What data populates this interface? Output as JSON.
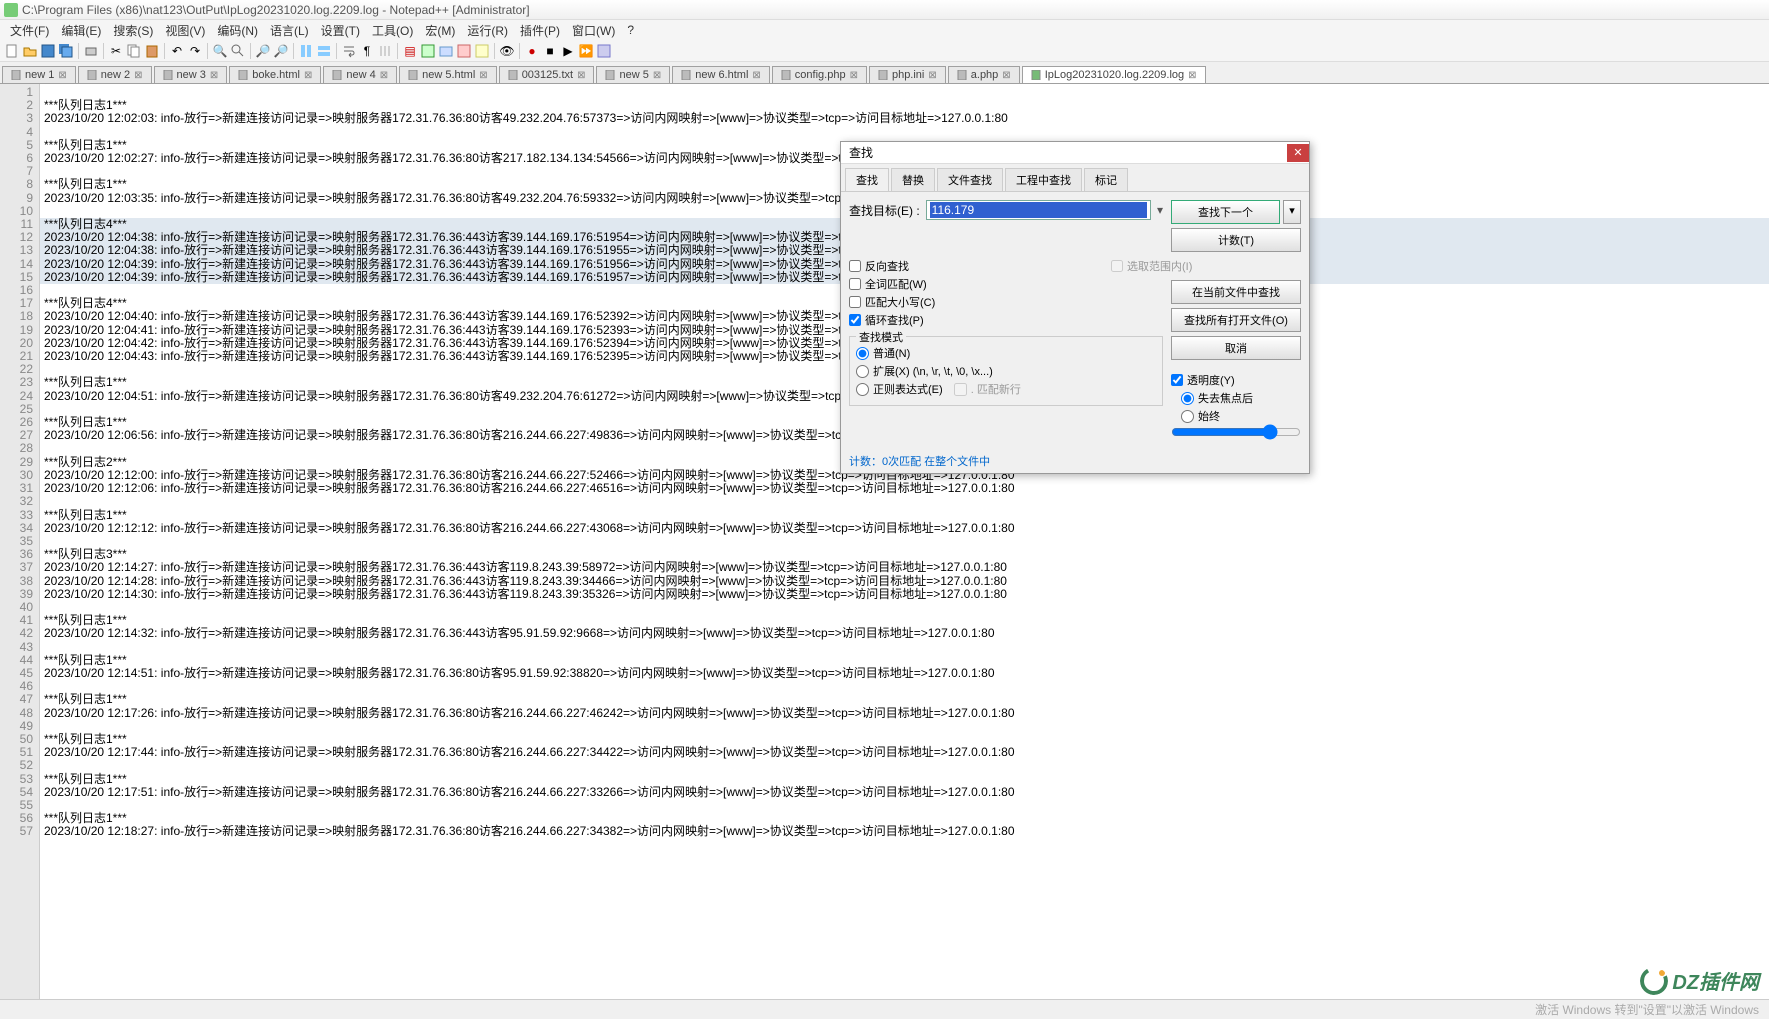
{
  "title": "C:\\Program Files (x86)\\nat123\\OutPut\\IpLog20231020.log.2209.log - Notepad++ [Administrator]",
  "menus": [
    "文件(F)",
    "编辑(E)",
    "搜索(S)",
    "视图(V)",
    "编码(N)",
    "语言(L)",
    "设置(T)",
    "工具(O)",
    "宏(M)",
    "运行(R)",
    "插件(P)",
    "窗口(W)",
    "?"
  ],
  "tabs": [
    {
      "label": "new 1",
      "active": false
    },
    {
      "label": "new 2",
      "active": false
    },
    {
      "label": "new 3",
      "active": false
    },
    {
      "label": "boke.html",
      "active": false
    },
    {
      "label": "new 4",
      "active": false
    },
    {
      "label": "new 5.html",
      "active": false
    },
    {
      "label": "003125.txt",
      "active": false
    },
    {
      "label": "new 5",
      "active": false
    },
    {
      "label": "new 6.html",
      "active": false
    },
    {
      "label": "config.php",
      "active": false
    },
    {
      "label": "php.ini",
      "active": false
    },
    {
      "label": "a.php",
      "active": false
    },
    {
      "label": "IpLog20231020.log.2209.log",
      "active": true
    }
  ],
  "lines": [
    {
      "n": 1,
      "t": ""
    },
    {
      "n": 2,
      "t": "***队列日志1***"
    },
    {
      "n": 3,
      "t": "2023/10/20 12:02:03: info-放行=>新建连接访问记录=>映射服务器172.31.76.36:80访客49.232.204.76:57373=>访问内网映射=>[www]=>协议类型=>tcp=>访问目标地址=>127.0.0.1:80"
    },
    {
      "n": 4,
      "t": ""
    },
    {
      "n": 5,
      "t": "***队列日志1***"
    },
    {
      "n": 6,
      "t": "2023/10/20 12:02:27: info-放行=>新建连接访问记录=>映射服务器172.31.76.36:80访客217.182.134.134:54566=>访问内网映射=>[www]=>协议类型=>tcp=>访问目标地址=>127.0.0.1:80"
    },
    {
      "n": 7,
      "t": ""
    },
    {
      "n": 8,
      "t": "***队列日志1***"
    },
    {
      "n": 9,
      "t": "2023/10/20 12:03:35: info-放行=>新建连接访问记录=>映射服务器172.31.76.36:80访客49.232.204.76:59332=>访问内网映射=>[www]=>协议类型=>tcp=>访问目标地址=>127.0.0.1:80"
    },
    {
      "n": 10,
      "t": ""
    },
    {
      "n": 11,
      "t": "***队列日志4***",
      "hl": true
    },
    {
      "n": 12,
      "t": "2023/10/20 12:04:38: info-放行=>新建连接访问记录=>映射服务器172.31.76.36:443访客39.144.169.176:51954=>访问内网映射=>[www]=>协议类型=>tcp=>访问目标地址=>127.0.0.1:80",
      "hl": true
    },
    {
      "n": 13,
      "t": "2023/10/20 12:04:38: info-放行=>新建连接访问记录=>映射服务器172.31.76.36:443访客39.144.169.176:51955=>访问内网映射=>[www]=>协议类型=>tcp=>访问目标地址=>127.0.0.1:80",
      "hl": true
    },
    {
      "n": 14,
      "t": "2023/10/20 12:04:39: info-放行=>新建连接访问记录=>映射服务器172.31.76.36:443访客39.144.169.176:51956=>访问内网映射=>[www]=>协议类型=>tcp=>访问目标地址=>127.0.0.1:80",
      "hl": true
    },
    {
      "n": 15,
      "t": "2023/10/20 12:04:39: info-放行=>新建连接访问记录=>映射服务器172.31.76.36:443访客39.144.169.176:51957=>访问内网映射=>[www]=>协议类型=>tcp=>访问目标地址=>127.0.0.1:80",
      "hl": true
    },
    {
      "n": 16,
      "t": ""
    },
    {
      "n": 17,
      "t": "***队列日志4***"
    },
    {
      "n": 18,
      "t": "2023/10/20 12:04:40: info-放行=>新建连接访问记录=>映射服务器172.31.76.36:443访客39.144.169.176:52392=>访问内网映射=>[www]=>协议类型=>tcp=>访问目标地址=>127.0.0.1:80"
    },
    {
      "n": 19,
      "t": "2023/10/20 12:04:41: info-放行=>新建连接访问记录=>映射服务器172.31.76.36:443访客39.144.169.176:52393=>访问内网映射=>[www]=>协议类型=>tcp=>访问目标地址=>127.0.0.1:80"
    },
    {
      "n": 20,
      "t": "2023/10/20 12:04:42: info-放行=>新建连接访问记录=>映射服务器172.31.76.36:443访客39.144.169.176:52394=>访问内网映射=>[www]=>协议类型=>tcp=>访问目标地址=>127.0.0.1:80"
    },
    {
      "n": 21,
      "t": "2023/10/20 12:04:43: info-放行=>新建连接访问记录=>映射服务器172.31.76.36:443访客39.144.169.176:52395=>访问内网映射=>[www]=>协议类型=>tcp=>访问目标地址=>127.0.0.1:80"
    },
    {
      "n": 22,
      "t": ""
    },
    {
      "n": 23,
      "t": "***队列日志1***"
    },
    {
      "n": 24,
      "t": "2023/10/20 12:04:51: info-放行=>新建连接访问记录=>映射服务器172.31.76.36:80访客49.232.204.76:61272=>访问内网映射=>[www]=>协议类型=>tcp=>访问目标地址=>127.0.0.1:80"
    },
    {
      "n": 25,
      "t": ""
    },
    {
      "n": 26,
      "t": "***队列日志1***"
    },
    {
      "n": 27,
      "t": "2023/10/20 12:06:56: info-放行=>新建连接访问记录=>映射服务器172.31.76.36:80访客216.244.66.227:49836=>访问内网映射=>[www]=>协议类型=>tcp=>访问目标地址=>127.0.0.1:80"
    },
    {
      "n": 28,
      "t": ""
    },
    {
      "n": 29,
      "t": "***队列日志2***"
    },
    {
      "n": 30,
      "t": "2023/10/20 12:12:00: info-放行=>新建连接访问记录=>映射服务器172.31.76.36:80访客216.244.66.227:52466=>访问内网映射=>[www]=>协议类型=>tcp=>访问目标地址=>127.0.0.1:80"
    },
    {
      "n": 31,
      "t": "2023/10/20 12:12:06: info-放行=>新建连接访问记录=>映射服务器172.31.76.36:80访客216.244.66.227:46516=>访问内网映射=>[www]=>协议类型=>tcp=>访问目标地址=>127.0.0.1:80"
    },
    {
      "n": 32,
      "t": ""
    },
    {
      "n": 33,
      "t": "***队列日志1***"
    },
    {
      "n": 34,
      "t": "2023/10/20 12:12:12: info-放行=>新建连接访问记录=>映射服务器172.31.76.36:80访客216.244.66.227:43068=>访问内网映射=>[www]=>协议类型=>tcp=>访问目标地址=>127.0.0.1:80"
    },
    {
      "n": 35,
      "t": ""
    },
    {
      "n": 36,
      "t": "***队列日志3***"
    },
    {
      "n": 37,
      "t": "2023/10/20 12:14:27: info-放行=>新建连接访问记录=>映射服务器172.31.76.36:443访客119.8.243.39:58972=>访问内网映射=>[www]=>协议类型=>tcp=>访问目标地址=>127.0.0.1:80"
    },
    {
      "n": 38,
      "t": "2023/10/20 12:14:28: info-放行=>新建连接访问记录=>映射服务器172.31.76.36:443访客119.8.243.39:34466=>访问内网映射=>[www]=>协议类型=>tcp=>访问目标地址=>127.0.0.1:80"
    },
    {
      "n": 39,
      "t": "2023/10/20 12:14:30: info-放行=>新建连接访问记录=>映射服务器172.31.76.36:443访客119.8.243.39:35326=>访问内网映射=>[www]=>协议类型=>tcp=>访问目标地址=>127.0.0.1:80"
    },
    {
      "n": 40,
      "t": ""
    },
    {
      "n": 41,
      "t": "***队列日志1***"
    },
    {
      "n": 42,
      "t": "2023/10/20 12:14:32: info-放行=>新建连接访问记录=>映射服务器172.31.76.36:443访客95.91.59.92:9668=>访问内网映射=>[www]=>协议类型=>tcp=>访问目标地址=>127.0.0.1:80"
    },
    {
      "n": 43,
      "t": ""
    },
    {
      "n": 44,
      "t": "***队列日志1***"
    },
    {
      "n": 45,
      "t": "2023/10/20 12:14:51: info-放行=>新建连接访问记录=>映射服务器172.31.76.36:80访客95.91.59.92:38820=>访问内网映射=>[www]=>协议类型=>tcp=>访问目标地址=>127.0.0.1:80"
    },
    {
      "n": 46,
      "t": ""
    },
    {
      "n": 47,
      "t": "***队列日志1***"
    },
    {
      "n": 48,
      "t": "2023/10/20 12:17:26: info-放行=>新建连接访问记录=>映射服务器172.31.76.36:80访客216.244.66.227:46242=>访问内网映射=>[www]=>协议类型=>tcp=>访问目标地址=>127.0.0.1:80"
    },
    {
      "n": 49,
      "t": ""
    },
    {
      "n": 50,
      "t": "***队列日志1***"
    },
    {
      "n": 51,
      "t": "2023/10/20 12:17:44: info-放行=>新建连接访问记录=>映射服务器172.31.76.36:80访客216.244.66.227:34422=>访问内网映射=>[www]=>协议类型=>tcp=>访问目标地址=>127.0.0.1:80"
    },
    {
      "n": 52,
      "t": ""
    },
    {
      "n": 53,
      "t": "***队列日志1***"
    },
    {
      "n": 54,
      "t": "2023/10/20 12:17:51: info-放行=>新建连接访问记录=>映射服务器172.31.76.36:80访客216.244.66.227:33266=>访问内网映射=>[www]=>协议类型=>tcp=>访问目标地址=>127.0.0.1:80"
    },
    {
      "n": 55,
      "t": ""
    },
    {
      "n": 56,
      "t": "***队列日志1***"
    },
    {
      "n": 57,
      "t": "2023/10/20 12:18:27: info-放行=>新建连接访问记录=>映射服务器172.31.76.36:80访客216.244.66.227:34382=>访问内网映射=>[www]=>协议类型=>tcp=>访问目标地址=>127.0.0.1:80"
    }
  ],
  "find": {
    "title": "查找",
    "tabs": [
      "查找",
      "替换",
      "文件查找",
      "工程中查找",
      "标记"
    ],
    "target_label": "查找目标(E) :",
    "target_value": "116.179",
    "btn_next": "查找下一个",
    "btn_count": "计数(T)",
    "btn_findall_current": "在当前文件中查找",
    "btn_findall_open": "查找所有打开文件(O)",
    "btn_cancel": "取消",
    "chk_in_selection": "选取范围内(I)",
    "chk_backward": "反向查找",
    "chk_whole": "全词匹配(W)",
    "chk_case": "匹配大小写(C)",
    "chk_wrap": "循环查找(P)",
    "mode_legend": "查找模式",
    "mode_normal": "普通(N)",
    "mode_extended": "扩展(X) (\\n, \\r, \\t, \\0, \\x...)",
    "mode_regex": "正则表达式(E)",
    "mode_dotnl": ". 匹配新行",
    "trans_legend": "透明度(Y)",
    "trans_lostfocus": "失去焦点后",
    "trans_always": "始终",
    "status": "计数：0次匹配 在整个文件中"
  },
  "statusbar": {
    "right": "激活 Windows  转到\"设置\"以激活 Windows"
  },
  "watermark": "DZ插件网"
}
